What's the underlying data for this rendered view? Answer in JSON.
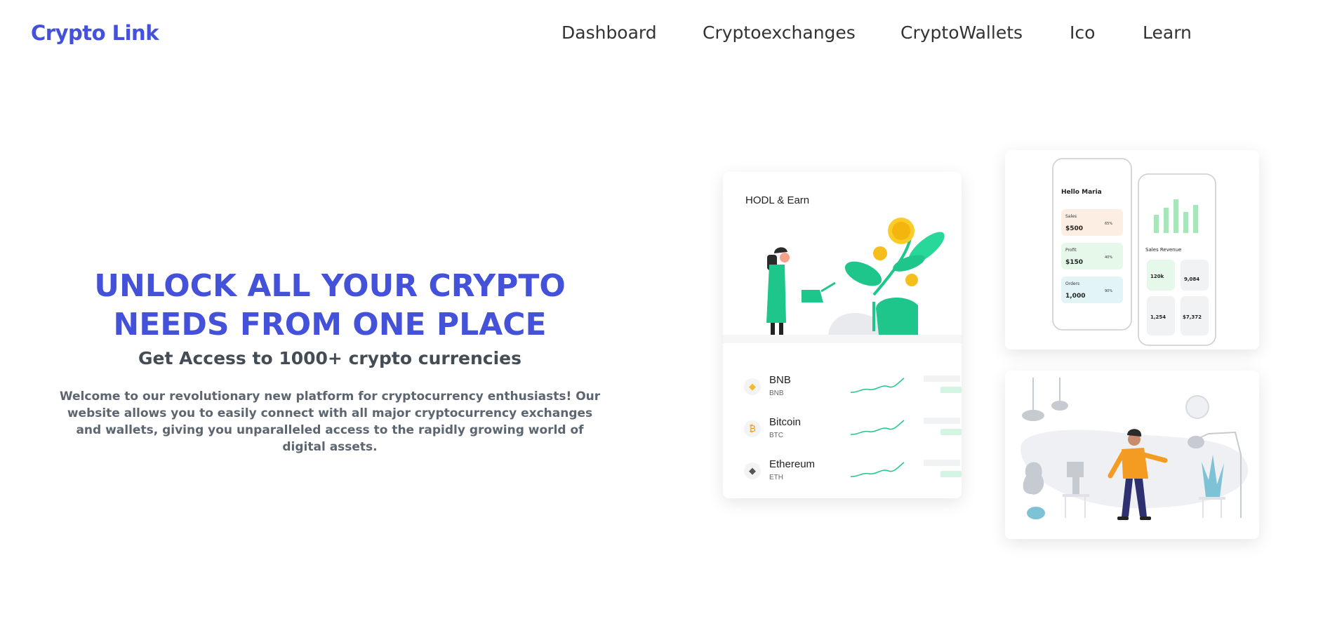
{
  "brand": "Crypto Link",
  "nav": [
    {
      "label": "Dashboard"
    },
    {
      "label": "Cryptoexchanges"
    },
    {
      "label": "CryptoWallets"
    },
    {
      "label": "Ico"
    },
    {
      "label": "Learn"
    }
  ],
  "hero": {
    "title_line1": "UNLOCK ALL YOUR CRYPTO",
    "title_line2": "NEEDS FROM ONE PLACE",
    "subtitle": "Get Access to 1000+ crypto currencies",
    "description": "Welcome to our revolutionary new platform for cryptocurrency enthusiasts! Our website allows you to easily connect with all major cryptocurrency exchanges and wallets, giving you unparalleled access to the rapidly growing world of digital assets."
  },
  "hodl_card": {
    "title": "HODL & Earn",
    "coins": [
      {
        "name": "BNB",
        "symbol": "BNB",
        "icon": "bnb-icon",
        "color": "#f3ba2f"
      },
      {
        "name": "Bitcoin",
        "symbol": "BTC",
        "icon": "bitcoin-icon",
        "color": "#f7931a"
      },
      {
        "name": "Ethereum",
        "symbol": "ETH",
        "icon": "ethereum-icon",
        "color": "#555555"
      }
    ]
  },
  "phone_mockup": {
    "greeting": "Hello Maria",
    "cards": [
      {
        "label": "Sales",
        "value": "$500",
        "percent": "65%",
        "color": "#fdeee3"
      },
      {
        "label": "Profit",
        "value": "$150",
        "percent": "40%",
        "color": "#e6f8ea"
      },
      {
        "label": "Orders",
        "value": "1,000",
        "percent": "90%",
        "color": "#e3f4f7"
      }
    ],
    "sales_revenue_label": "Sales Revenue",
    "stats": [
      "120k",
      "9,084",
      "1,254",
      "$7,372"
    ]
  },
  "colors": {
    "accent": "#4451d9",
    "green": "#1fc68b",
    "text": "#333333"
  }
}
